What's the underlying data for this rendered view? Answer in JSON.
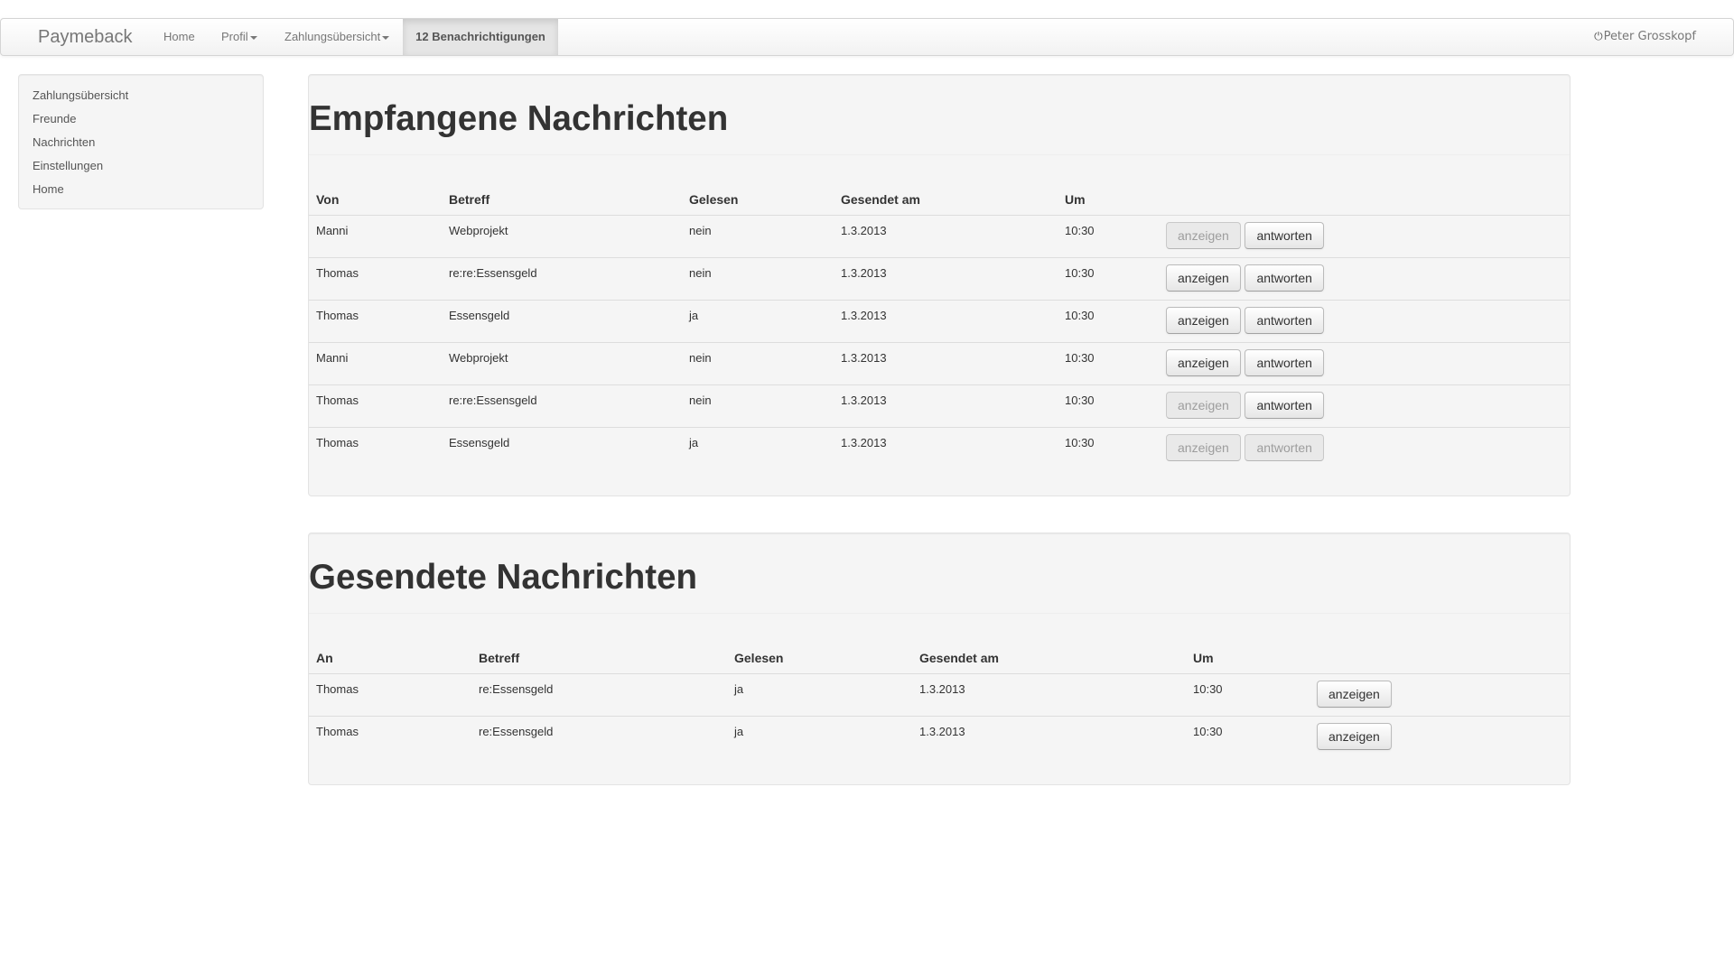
{
  "navbar": {
    "brand": "Paymeback",
    "items": [
      {
        "label": "Home",
        "dropdown": false
      },
      {
        "label": "Profil",
        "dropdown": true
      },
      {
        "label": "Zahlungsübersicht",
        "dropdown": true
      }
    ],
    "active_item": "12 Benachrichtigungen",
    "user": {
      "icon": "power-icon",
      "name": "Peter Grosskopf"
    }
  },
  "sidebar": {
    "items": [
      {
        "label": "Zahlungsübersicht"
      },
      {
        "label": "Freunde"
      },
      {
        "label": "Nachrichten"
      },
      {
        "label": "Einstellungen"
      },
      {
        "label": "Home"
      }
    ]
  },
  "received": {
    "title": "Empfangene Nachrichten",
    "columns": [
      "Von",
      "Betreff",
      "Gelesen",
      "Gesendet am",
      "Um"
    ],
    "rows": [
      {
        "from": "Manni",
        "subject": "Webprojekt",
        "read": "nein",
        "date": "1.3.2013",
        "time": "10:30",
        "show_label": "anzeigen",
        "show_disabled": true,
        "reply_label": "antworten",
        "reply_disabled": false
      },
      {
        "from": "Thomas",
        "subject": "re:re:Essensgeld",
        "read": "nein",
        "date": "1.3.2013",
        "time": "10:30",
        "show_label": "anzeigen",
        "show_disabled": false,
        "reply_label": "antworten",
        "reply_disabled": false
      },
      {
        "from": "Thomas",
        "subject": "Essensgeld",
        "read": "ja",
        "date": "1.3.2013",
        "time": "10:30",
        "show_label": "anzeigen",
        "show_disabled": false,
        "reply_label": "antworten",
        "reply_disabled": false
      },
      {
        "from": "Manni",
        "subject": "Webprojekt",
        "read": "nein",
        "date": "1.3.2013",
        "time": "10:30",
        "show_label": "anzeigen",
        "show_disabled": false,
        "reply_label": "antworten",
        "reply_disabled": false
      },
      {
        "from": "Thomas",
        "subject": "re:re:Essensgeld",
        "read": "nein",
        "date": "1.3.2013",
        "time": "10:30",
        "show_label": "anzeigen",
        "show_disabled": true,
        "reply_label": "antworten",
        "reply_disabled": false
      },
      {
        "from": "Thomas",
        "subject": "Essensgeld",
        "read": "ja",
        "date": "1.3.2013",
        "time": "10:30",
        "show_label": "anzeigen",
        "show_disabled": true,
        "reply_label": "antworten",
        "reply_disabled": true
      }
    ]
  },
  "sent": {
    "title": "Gesendete Nachrichten",
    "columns": [
      "An",
      "Betreff",
      "Gelesen",
      "Gesendet am",
      "Um"
    ],
    "rows": [
      {
        "to": "Thomas",
        "subject": "re:Essensgeld",
        "read": "ja",
        "date": "1.3.2013",
        "time": "10:30",
        "show_label": "anzeigen",
        "show_disabled": false
      },
      {
        "to": "Thomas",
        "subject": "re:Essensgeld",
        "read": "ja",
        "date": "1.3.2013",
        "time": "10:30",
        "show_label": "anzeigen",
        "show_disabled": false
      }
    ]
  }
}
